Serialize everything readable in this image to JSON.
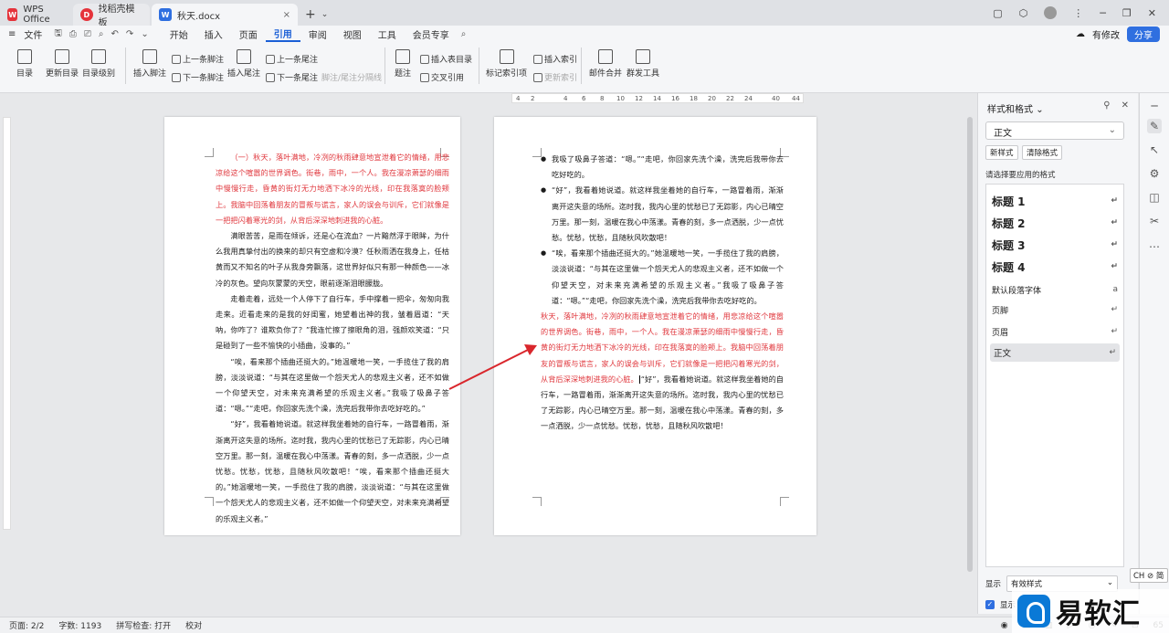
{
  "tabs": {
    "wps": "WPS Office",
    "template": "找稻壳模板",
    "doc": "秋天.docx",
    "close": "×",
    "new": "+"
  },
  "menu": {
    "file": "文件",
    "items": [
      "开始",
      "插入",
      "页面",
      "引用",
      "审阅",
      "视图",
      "工具",
      "会员专享"
    ],
    "selected_index": 3,
    "has_edit": "有修改",
    "share": "分享"
  },
  "ribbon": {
    "toc": "目录",
    "update_toc": "更新目录",
    "toc_level": "目录级别",
    "insert_footnote": "插入脚注",
    "prev_footnote": "上一条脚注",
    "next_footnote": "下一条脚注",
    "insert_endnote": "插入尾注",
    "prev_endnote": "上一条尾注",
    "next_endnote": "下一条尾注",
    "footnote_sep": "脚注/尾注分隔线",
    "caption": "题注",
    "insert_table_toc": "插入表目录",
    "cross_ref": "交叉引用",
    "mark_index": "标记索引项",
    "insert_index": "插入索引",
    "update_index": "更新索引",
    "mail_merge": "邮件合并",
    "group_send": "群发工具"
  },
  "ruler": {
    "labels": [
      "4",
      "2",
      "2",
      "4",
      "6",
      "8",
      "10",
      "12",
      "14",
      "16",
      "18",
      "20",
      "22",
      "24",
      "26",
      "28",
      "30",
      "32",
      "34",
      "36",
      "38",
      "40",
      "44"
    ],
    "vlabels": [
      "2",
      "2",
      "4",
      "6",
      "8",
      "10",
      "12",
      "14",
      "16",
      "18",
      "20",
      "22",
      "24",
      "26",
      "28",
      "30",
      "32",
      "34",
      "36",
      "38"
    ]
  },
  "page1": {
    "red": "（一）秋天，落叶满地，冷冽的秋雨肆意地宣泄着它的情绪，用悲凉给这个喧嚣的世界调色。街巷，雨中，一个人。我在漫凉萧瑟的细雨中慢慢行走，昏黄的街灯无力地洒下冰冷的光线，印在我落寞的脸颊上。我脑中回荡着朋友的冒叛与谎言，家人的误会与训斥，它们就像是一把把闪着寒光的剑，从背后深深地刺进我的心脏。",
    "p1": "满眼苦苦，是雨在倾诉，还是心在流血？一片黯然浮于眼眸，为什么我用真挚付出的换来的却只有空虚和冷漠？任秋雨洒在我身上，任枯黄而又不知名的叶子从我身旁飘落，这世界好似只有那一种颜色——冰冷的灰色。望向灰蒙蒙的天空，眼前逐渐泪眼朦胧。",
    "p2": "走着走着，远处一个人停下了自行车，手中撑着一把伞，匆匆向我走来。近看走来的是我的好闺蜜，她望着出神的我，皱着眉道：“天呐，你咋了？谁欺负你了？”我连忙擦了擦眼角的泪，强颜欢笑道：“只是碰到了一些不愉快的小插曲，没事的。”",
    "p3": "“唉，看来那个插曲还挺大的。”她温暖地一笑，一手揽住了我的肩膀，淡淡说道：“与其在这里做一个怨天尤人的悲观主义者，还不如做一个仰望天空，对未来充满希望的乐观主义者。”我吸了吸鼻子答道：“嗯。”“走吧，你回家先洗个澡，洗完后我带你去吃好吃的。”",
    "p4": "“好”，我看着她说道。就这样我坐着她的自行车，一路冒着雨，渐渐离开这失意的场所。迄时我，我内心里的忧愁已了无踪影，内心已晴空万里。那一刻，温暖在我心中荡漾。青春的刻，多一点洒脱，少一点忧愁。忧愁，忧愁，且随秋风吹散吧！“唉，看来那个插曲还挺大的。”她温暖地一笑，一手揽住了我的肩膀，淡淡说道：“与其在这里做一个怨天尤人的悲观主义者，还不如做一个仰望天空，对未来充满希望的乐观主义者。”"
  },
  "page2": {
    "b1": "我吸了吸鼻子答道：“嗯。”“走吧，你回家先洗个澡，洗完后我带你去吃好吃的。",
    "b2": "“好”，我看着她说道。就这样我坐着她的自行车，一路冒着雨，渐渐离开这失意的场所。迄时我，我内心里的忧愁已了无踪影，内心已晴空万里。那一刻，温暖在我心中荡漾。青春的刻，多一点洒脱，少一点忧愁。忧愁，忧愁，且随秋风吹散吧！",
    "b3": "“唉，看来那个插曲还挺大的。”她温暖地一笑，一手揽住了我的肩膀，淡淡说道：“与其在这里做一个怨天尤人的悲观主义者，还不如做一个仰望天空，对未来充满希望的乐观主义者。”我吸了吸鼻子答道：“嗯。”“走吧，你回家先洗个澡，洗完后我带你去吃好吃的。",
    "red": "秋天，落叶满地，冷冽的秋雨肆意地宣泄着它的情绪，用悲凉给这个喧嚣的世界调色。街巷，雨中，一个人。我在漫凉萧瑟的细雨中慢慢行走，昏黄的街灯无力地洒下冰冷的光线，印在我落寞的脸颊上。我脑中回荡着朋友的冒叛与谎言，家人的误会与训斥，它们就像是一把把闪着寒光的剑，从背后深深地刺进我的心脏。",
    "tail": "“好”，我看着她说道。就这样我坐着她的自行车，一路冒着雨，渐渐离开这失意的场所。迄时我，我内心里的忧愁已了无踪影，内心已晴空万里。那一刻，温暖在我心中荡漾。青春的刻，多一点洒脱，少一点忧愁。忧愁，忧愁，且随秋风吹散吧！"
  },
  "panel": {
    "title": "样式和格式",
    "current": "正文",
    "new_style": "新样式",
    "clear_format": "清除格式",
    "choose_label": "请选择要应用的格式",
    "styles": [
      {
        "name": "标题 1",
        "en": "↵"
      },
      {
        "name": "标题 2",
        "en": "↵"
      },
      {
        "name": "标题 3",
        "en": "↵"
      },
      {
        "name": "标题 4",
        "en": "↵"
      },
      {
        "name": "默认段落字体",
        "en": "a"
      },
      {
        "name": "页脚",
        "en": "↵"
      },
      {
        "name": "页眉",
        "en": "↵"
      },
      {
        "name": "正文",
        "en": "↵"
      }
    ],
    "show_label": "显示",
    "show_value": "有效样式",
    "show_preview": "显示"
  },
  "status": {
    "page": "页面: 2/2",
    "words": "字数: 1193",
    "spell": "拼写检查: 打开",
    "proof": "校对",
    "zoom": "65"
  },
  "ime": "CH ⊘ 简",
  "watermark": "易软汇",
  "colors": {
    "accent": "#1a5fd6",
    "red_text": "#e0383e",
    "arrow": "#d9262c"
  }
}
